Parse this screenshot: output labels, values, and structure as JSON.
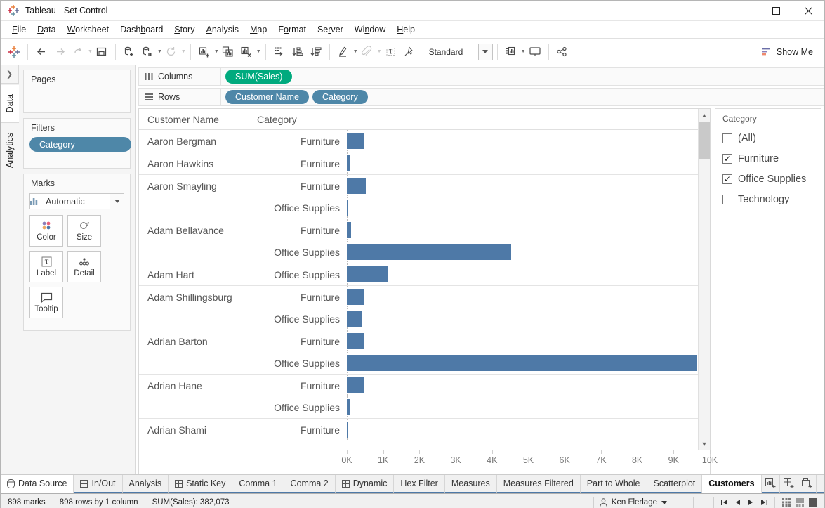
{
  "window": {
    "title": "Tableau - Set Control",
    "app_icon": "tableau-logo-icon",
    "minimize": "minimize-icon",
    "maximize": "maximize-icon",
    "close": "close-icon"
  },
  "menu": {
    "items": [
      {
        "label": "File",
        "accel": "F"
      },
      {
        "label": "Data",
        "accel": "D"
      },
      {
        "label": "Worksheet",
        "accel": "W"
      },
      {
        "label": "Dashboard",
        "accel": "B"
      },
      {
        "label": "Story",
        "accel": "S"
      },
      {
        "label": "Analysis",
        "accel": "A"
      },
      {
        "label": "Map",
        "accel": "M"
      },
      {
        "label": "Format",
        "accel": "o"
      },
      {
        "label": "Server",
        "accel": "r"
      },
      {
        "label": "Window",
        "accel": "n"
      },
      {
        "label": "Help",
        "accel": "H"
      }
    ]
  },
  "toolbar": {
    "fit_value": "Standard",
    "show_me_label": "Show Me",
    "buttons": [
      "tableau-home-icon",
      "undo-icon",
      "redo-icon",
      "revert-icon",
      "save-icon",
      "add-data-source-icon",
      "pause-updates-icon",
      "refresh-icon",
      "new-worksheet-icon",
      "duplicate-sheet-icon",
      "clear-sheet-icon",
      "swap-axes-icon",
      "sort-ascending-icon",
      "sort-descending-icon",
      "highlight-icon",
      "attach-icon",
      "text-label-icon",
      "fix-axis-icon",
      "presentation-cards-icon",
      "presentation-mode-icon",
      "share-icon"
    ]
  },
  "left_rail": {
    "expand": "expand-panel-icon",
    "tabs": [
      {
        "label": "Data",
        "active": true
      },
      {
        "label": "Analytics",
        "active": false
      }
    ]
  },
  "cards": {
    "pages": {
      "title": "Pages"
    },
    "filters": {
      "title": "Filters",
      "pills": [
        "Category"
      ]
    },
    "marks": {
      "title": "Marks",
      "mark_type": "Automatic",
      "mark_type_icon": "bar-mark-icon",
      "buttons": [
        {
          "label": "Color",
          "icon": "color-palette-icon"
        },
        {
          "label": "Size",
          "icon": "size-icon"
        },
        {
          "label": "Label",
          "icon": "label-text-icon"
        },
        {
          "label": "Detail",
          "icon": "detail-dots-icon"
        },
        {
          "label": "Tooltip",
          "icon": "tooltip-bubble-icon"
        }
      ]
    }
  },
  "shelves": {
    "columns": {
      "label": "Columns",
      "icon": "columns-icon",
      "pills": [
        "SUM(Sales)"
      ]
    },
    "rows": {
      "label": "Rows",
      "icon": "rows-icon",
      "pills": [
        "Customer Name",
        "Category"
      ]
    }
  },
  "filter_card": {
    "title": "Category",
    "items": [
      {
        "label": "(All)",
        "checked": false
      },
      {
        "label": "Furniture",
        "checked": true
      },
      {
        "label": "Office Supplies",
        "checked": true
      },
      {
        "label": "Technology",
        "checked": false
      }
    ]
  },
  "chart_data": {
    "type": "bar",
    "title": "",
    "orientation": "horizontal",
    "xlabel": "SUM(Sales)",
    "ylabel": "Customer Name / Category",
    "headers": {
      "name": "Customer Name",
      "category": "Category"
    },
    "xlim": [
      0,
      10000
    ],
    "xticks": [
      0,
      1000,
      2000,
      3000,
      4000,
      5000,
      6000,
      7000,
      8000,
      9000,
      10000
    ],
    "xticklabels": [
      "0K",
      "1K",
      "2K",
      "3K",
      "4K",
      "5K",
      "6K",
      "7K",
      "8K",
      "9K",
      "10K"
    ],
    "grid": false,
    "bar_color": "#4e79a7",
    "groups": [
      {
        "name": "Aaron Bergman",
        "rows": [
          {
            "category": "Furniture",
            "value": 500
          }
        ]
      },
      {
        "name": "Aaron Hawkins",
        "rows": [
          {
            "category": "Furniture",
            "value": 110
          }
        ]
      },
      {
        "name": "Aaron Smayling",
        "rows": [
          {
            "category": "Furniture",
            "value": 530
          },
          {
            "category": "Office Supplies",
            "value": 35
          }
        ]
      },
      {
        "name": "Adam Bellavance",
        "rows": [
          {
            "category": "Furniture",
            "value": 120
          },
          {
            "category": "Office Supplies",
            "value": 4680
          }
        ]
      },
      {
        "name": "Adam Hart",
        "rows": [
          {
            "category": "Office Supplies",
            "value": 1150
          }
        ]
      },
      {
        "name": "Adam Shillingsburg",
        "rows": [
          {
            "category": "Furniture",
            "value": 480
          },
          {
            "category": "Office Supplies",
            "value": 420
          }
        ]
      },
      {
        "name": "Adrian Barton",
        "rows": [
          {
            "category": "Furniture",
            "value": 470
          },
          {
            "category": "Office Supplies",
            "value": 9980
          }
        ]
      },
      {
        "name": "Adrian Hane",
        "rows": [
          {
            "category": "Furniture",
            "value": 490
          },
          {
            "category": "Office Supplies",
            "value": 95
          }
        ]
      },
      {
        "name": "Adrian Shami",
        "rows": [
          {
            "category": "Furniture",
            "value": 25
          }
        ]
      }
    ]
  },
  "worksheet_tabs": {
    "data_source": {
      "label": "Data Source",
      "icon": "data-source-icon"
    },
    "sheets": [
      {
        "label": "In/Out",
        "icon": "sheet-icon",
        "active": false
      },
      {
        "label": "Analysis",
        "icon": "",
        "active": false
      },
      {
        "label": "Static Key",
        "icon": "sheet-icon",
        "active": false
      },
      {
        "label": "Comma 1",
        "icon": "",
        "active": false
      },
      {
        "label": "Comma 2",
        "icon": "",
        "active": false
      },
      {
        "label": "Dynamic",
        "icon": "sheet-icon",
        "active": false
      },
      {
        "label": "Hex Filter",
        "icon": "",
        "active": false
      },
      {
        "label": "Measures",
        "icon": "",
        "active": false
      },
      {
        "label": "Measures Filtered",
        "icon": "",
        "active": false
      },
      {
        "label": "Part to Whole",
        "icon": "",
        "active": false
      },
      {
        "label": "Scatterplot",
        "icon": "",
        "active": false
      },
      {
        "label": "Customers",
        "icon": "",
        "active": true
      }
    ],
    "add_buttons": [
      "new-worksheet-icon",
      "new-dashboard-icon",
      "new-story-icon"
    ]
  },
  "status_bar": {
    "marks": "898 marks",
    "rows_cols": "898 rows by 1 column",
    "aggregate": "SUM(Sales): 382,073",
    "user": "Ken Flerlage",
    "user_icon": "user-icon",
    "nav_icons": [
      "first-page-icon",
      "previous-page-icon",
      "next-page-icon",
      "last-page-icon"
    ],
    "view_icons": [
      "grid-view-icon",
      "filmstrip-view-icon",
      "single-view-icon"
    ]
  }
}
